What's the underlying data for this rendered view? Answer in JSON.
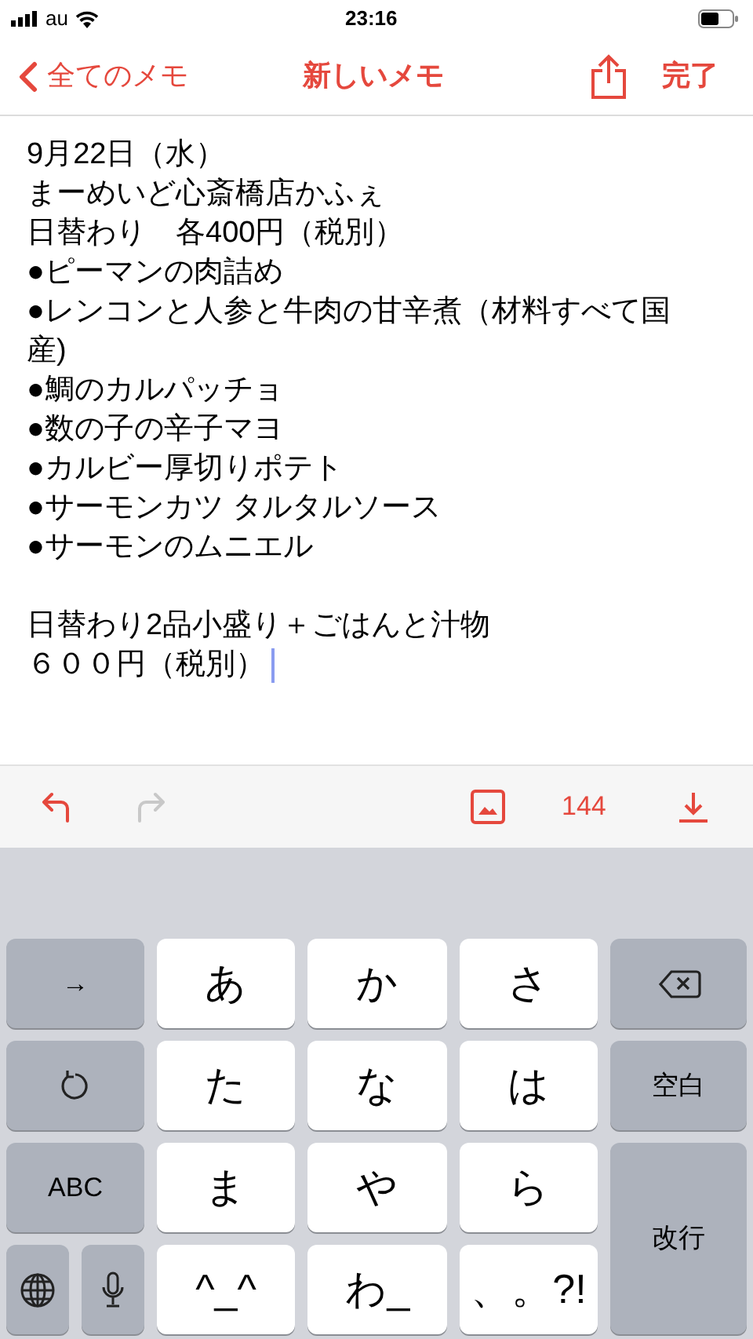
{
  "status_bar": {
    "carrier": "au",
    "time": "23:16"
  },
  "nav": {
    "back_label": "全てのメモ",
    "title": "新しいメモ",
    "done_label": "完了"
  },
  "note": {
    "paragraphs": [
      [
        "9月22日（水）",
        "まーめいど心斎橋店かふぇ",
        "日替わり　各400円（税別）",
        "●ピーマンの肉詰め",
        "●レンコンと人参と牛肉の甘辛煮（材料すべて国産)",
        "●鯛のカルパッチョ",
        "●数の子の辛子マヨ",
        "●カルビー厚切りポテト",
        "●サーモンカツ タルタルソース",
        "●サーモンのムニエル"
      ],
      [
        "日替わり2品小盛り＋ごはんと汁物",
        "６００円（税別）"
      ]
    ]
  },
  "toolbar": {
    "undo_disabled": false,
    "redo_disabled": true,
    "count": "144"
  },
  "keyboard": {
    "keys": [
      {
        "kind": "function",
        "label": "→"
      },
      {
        "kind": "kana",
        "label": "あ"
      },
      {
        "kind": "kana",
        "label": "か"
      },
      {
        "kind": "kana",
        "label": "さ"
      },
      {
        "kind": "backspace"
      },
      {
        "kind": "reset"
      },
      {
        "kind": "kana",
        "label": "た"
      },
      {
        "kind": "kana",
        "label": "な"
      },
      {
        "kind": "kana",
        "label": "は"
      },
      {
        "kind": "function",
        "label": "空白"
      },
      {
        "kind": "function",
        "label": "ABC"
      },
      {
        "kind": "kana",
        "label": "ま"
      },
      {
        "kind": "kana",
        "label": "や"
      },
      {
        "kind": "kana",
        "label": "ら"
      },
      {
        "kind": "enter",
        "label": "改行"
      },
      {
        "kind": "globe"
      },
      {
        "kind": "mic"
      },
      {
        "kind": "kana",
        "label": "^_^"
      },
      {
        "kind": "kana",
        "label": "わ_"
      },
      {
        "kind": "kana",
        "label": "、。?!"
      }
    ]
  }
}
